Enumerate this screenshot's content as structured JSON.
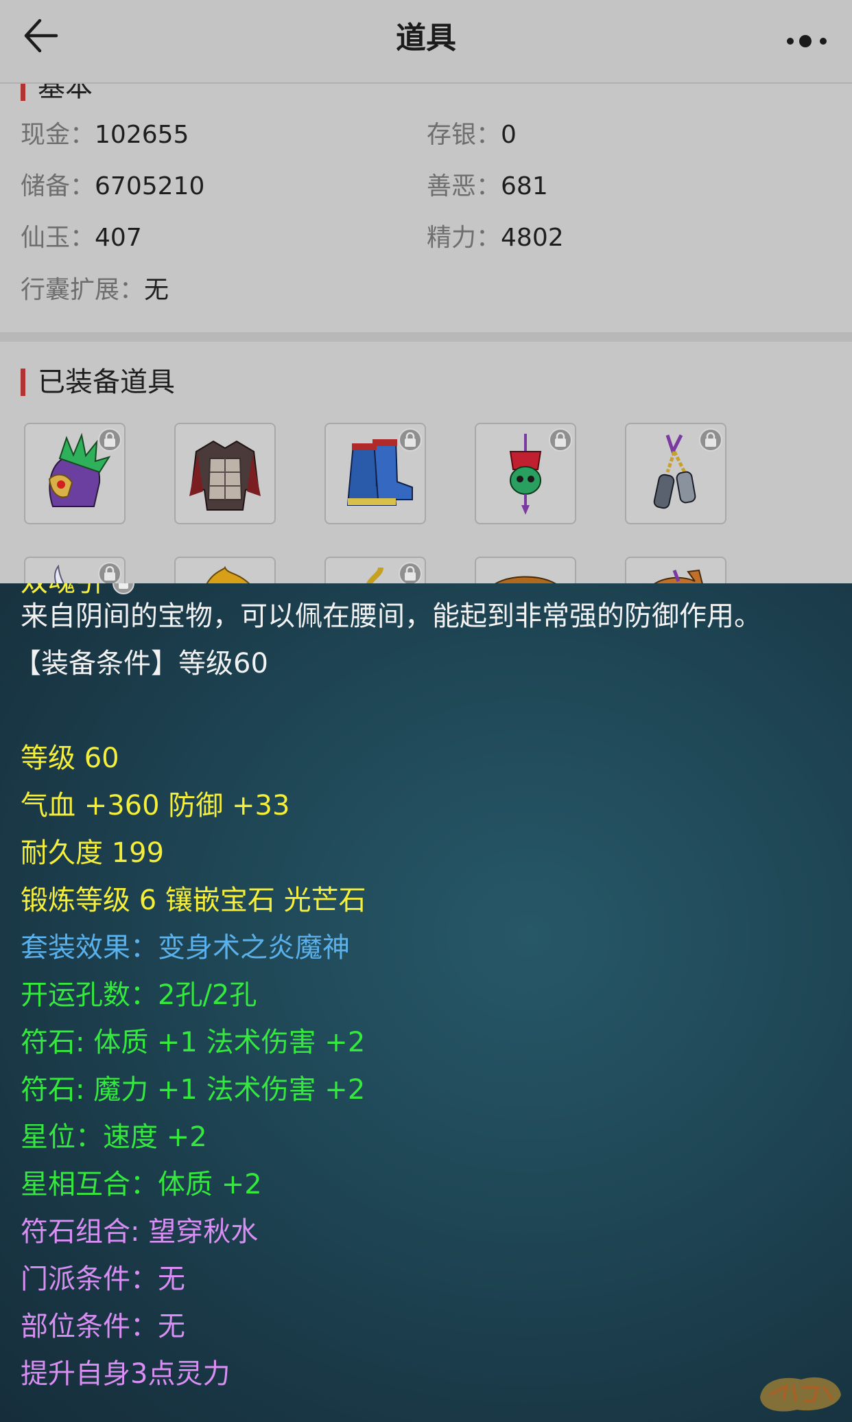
{
  "header": {
    "title": "道具",
    "back_icon": "arrow-left-icon",
    "more_icon": "more-dots-icon"
  },
  "basic": {
    "heading": "基本",
    "fields": [
      {
        "label": "现金：",
        "value": "102655"
      },
      {
        "label": "存银：",
        "value": "0"
      },
      {
        "label": "储备：",
        "value": "6705210"
      },
      {
        "label": "善恶：",
        "value": "681"
      },
      {
        "label": "仙玉：",
        "value": "407"
      },
      {
        "label": "精力：",
        "value": "4802"
      },
      {
        "label": "行囊扩展：",
        "value": "无"
      }
    ]
  },
  "equipped": {
    "heading": "已装备道具",
    "row1": [
      "helmet-icon",
      "armor-icon",
      "boots-icon",
      "skull-pendant-icon",
      "double-charm-icon"
    ],
    "row2": [
      "blade-icon",
      "leaf-icon",
      "serpent-icon",
      "hat-icon",
      "bag-icon"
    ]
  },
  "tooltip": {
    "item_name": "双魂引",
    "description": "来自阴间的宝物，可以佩在腰间，能起到非常强的防御作用。",
    "requirement": "【装备条件】等级60",
    "level": "等级 60",
    "stats": "气血 +360 防御 +33",
    "durability": "耐久度 199",
    "forge": "锻炼等级 6 镶嵌宝石 光芒石",
    "set_effect": "套装效果：变身术之炎魔神",
    "slots": "开运孔数：2孔/2孔",
    "rune1": "符石: 体质 +1 法术伤害 +2",
    "rune2": "符石: 魔力 +1 法术伤害 +2",
    "star": "星位：速度 +2",
    "star_match": "星相互合：体质 +2",
    "rune_combo": "符石组合: 望穿秋水",
    "school_req": "门派条件：无",
    "part_req": "部位条件：无",
    "bonus": "提升自身3点灵力"
  },
  "colors": {
    "description": "#f2f2f2",
    "base_attr": "#f5ee3a",
    "set_effect": "#5ab0ea",
    "rune": "#35e83e",
    "condition": "#d88ef2",
    "section_bar": "#b03434"
  }
}
